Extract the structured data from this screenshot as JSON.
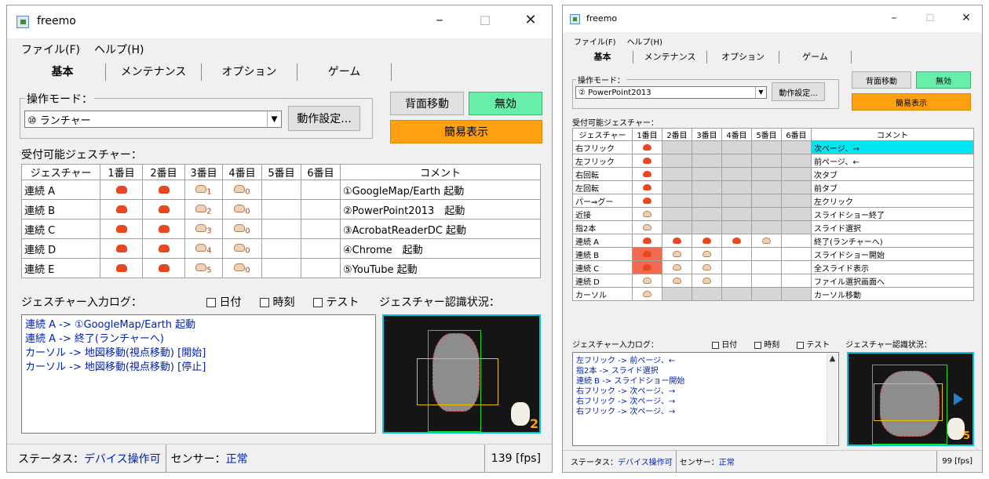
{
  "title": "freemo",
  "window_controls": {
    "minimize": "–",
    "maximize": "☐",
    "close": "✕"
  },
  "menu": [
    "ファイル(F)",
    "ヘルプ(H)"
  ],
  "tabs": [
    "基本",
    "メンテナンス",
    "オプション",
    "ゲーム"
  ],
  "op_mode_label": "操作モード：",
  "op_settings_button": "動作設定...",
  "bg_move_button": "背面移動",
  "disable_button": "無効",
  "simple_view_button": "簡易表示",
  "gestures_label": "受付可能ジェスチャー：",
  "log_label": "ジェスチャー入力ログ：",
  "checkboxes": [
    "日付",
    "時刻",
    "テスト"
  ],
  "recognition_label": "ジェスチャー認識状況：",
  "status": {
    "label": "ステータス：",
    "value": "デバイス操作可",
    "sensor_label": "センサー：",
    "sensor_value": "正常"
  },
  "colors": {
    "green": "#66eeaa",
    "orange": "#ffa010",
    "cyan": "#00e6f0",
    "red": "#f06a50",
    "log_text": "#0020b0"
  },
  "left": {
    "mode_value": "⑩ ランチャー",
    "table_headers": [
      "ジェスチャー",
      "1番目",
      "2番目",
      "3番目",
      "4番目",
      "5番目",
      "6番目",
      "コメント"
    ],
    "rows": [
      {
        "name": "連続 A",
        "comment": "①GoogleMap/Earth 起動",
        "num3": "1",
        "num4": "0"
      },
      {
        "name": "連続 B",
        "comment": "②PowerPoint2013　起動",
        "num3": "2",
        "num4": "0"
      },
      {
        "name": "連続 C",
        "comment": "③AcrobatReaderDC 起動",
        "num3": "3",
        "num4": "0"
      },
      {
        "name": "連続 D",
        "comment": "④Chrome　起動",
        "num3": "4",
        "num4": "0"
      },
      {
        "name": "連続 E",
        "comment": "⑤YouTube 起動",
        "num3": "5",
        "num4": "0"
      }
    ],
    "log": [
      "連続 A -> ①GoogleMap/Earth 起動",
      "連続 A -> 終了(ランチャーへ)",
      "カーソル -> 地図移動(視点移動) [開始]",
      "カーソル -> 地図移動(視点移動) [停止]"
    ],
    "fps": "139 [fps]",
    "camera_count": "2"
  },
  "right": {
    "mode_value": "② PowerPoint2013",
    "table_headers": [
      "ジェスチャー",
      "1番目",
      "2番目",
      "3番目",
      "4番目",
      "5番目",
      "6番目",
      "コメント"
    ],
    "rows": [
      {
        "name": "右フリック",
        "comment": "次ページ、→"
      },
      {
        "name": "左フリック",
        "comment": "前ページ、←"
      },
      {
        "name": "右回転",
        "comment": "次タブ"
      },
      {
        "name": "左回転",
        "comment": "前タブ"
      },
      {
        "name": "パー⇒グー",
        "comment": "左クリック"
      },
      {
        "name": "近接",
        "comment": "スライドショー終了"
      },
      {
        "name": "指2本",
        "comment": "スライド選択"
      },
      {
        "name": "連続 A",
        "comment": "終了(ランチャーへ)"
      },
      {
        "name": "連続 B",
        "comment": "スライドショー開始"
      },
      {
        "name": "連続 C",
        "comment": "全スライド表示"
      },
      {
        "name": "連続 D",
        "comment": "ファイル選択画面へ"
      },
      {
        "name": "カーソル",
        "comment": "カーソル移動"
      }
    ],
    "log": [
      "左フリック -> 前ページ、←",
      "指2本 -> スライド選択",
      "連続 B -> スライドショー開始",
      "右フリック -> 次ページ、→",
      "右フリック -> 次ページ、→",
      "右フリック -> 次ページ、→"
    ],
    "fps": "99 [fps]",
    "camera_count": "5"
  }
}
